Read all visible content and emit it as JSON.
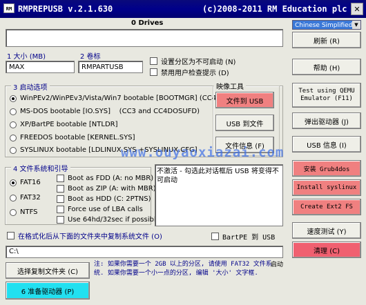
{
  "titlebar": {
    "title": "RMPREPUSB v.2.1.630",
    "copyright": "(c)2008-2011 RM Education plc",
    "icon_text": "RM",
    "close_glyph": "✕"
  },
  "drives": {
    "header": "0 Drives"
  },
  "language": {
    "selected": "Chinese Simplified"
  },
  "size": {
    "label": "1 大小 (MB)",
    "value": "MAX"
  },
  "volume": {
    "label": "2 卷标",
    "value": "RMPARTUSB"
  },
  "options": {
    "no_boot": "设置分区为不可启动 (N)",
    "disable_prompt": "禁用用户检查提示 (D)"
  },
  "boot": {
    "group_label": "3 启动选项",
    "items": [
      "WinPEv2/WinPEv3/Vista/Win7 bootable [BOOTMGR] (CC4)",
      "MS-DOS bootable [IO.SYS]    (CC3 and CC4DOSUFD)",
      "XP/BartPE bootable [NTLDR]",
      "FREEDOS bootable [KERNEL.SYS]",
      "SYSLINUX bootable [LDLINUX.SYS +SYSLINUX.CFG]"
    ]
  },
  "image_tools": {
    "group_label": "映像工具",
    "file_to_usb": "文件到 USB",
    "usb_to_file": "USB 到文件",
    "file_info": "文件信息 (F)"
  },
  "filesystem": {
    "group_label": "4 文件系统和引导",
    "fs": [
      "FAT16",
      "FAT32",
      "NTFS"
    ],
    "boot_as": [
      "Boot as FDD (A: no MBR)",
      "Boot as ZIP (A: with MBR)",
      "Boot as HDD (C: 2PTNS)",
      "Force use of LBA calls",
      "Use 64hd/32sec if possible"
    ]
  },
  "info_text": "不激活 - 勾选此对话框后 USB 将变得不可启动",
  "copy_sys_files": "在格式化后从下面的文件夹中复制系统文件 (O)",
  "bartpe": "BartPE 到 USB",
  "path_value": "C:\\",
  "choose_folder": "选择复制文件夹 (C)",
  "prepare_drive": "6 准备驱动器 (P)",
  "note": "注: 如果你需要一个 2GB 以上的分区, 请使用 FAT32 文件系统. 如果你需要一个小一点的分区, 编辑 '大小' 文字框.",
  "note_overflow": "启动",
  "right": {
    "refresh": "刷新 (R)",
    "help": "帮助 (H)",
    "qemu": "Test using QEMU Emulator (F11)",
    "eject": "弹出驱动器 (J)",
    "usb_info": "USB 信息 (I)",
    "grub4dos": "安装 Grub4dos",
    "syslinux": "Install syslinux",
    "ext2": "Create Ext2 FS",
    "speed": "速度测试 (Y)",
    "clean": "清理 (C)"
  },
  "watermark": "www.ouyaoxiazai.com"
}
